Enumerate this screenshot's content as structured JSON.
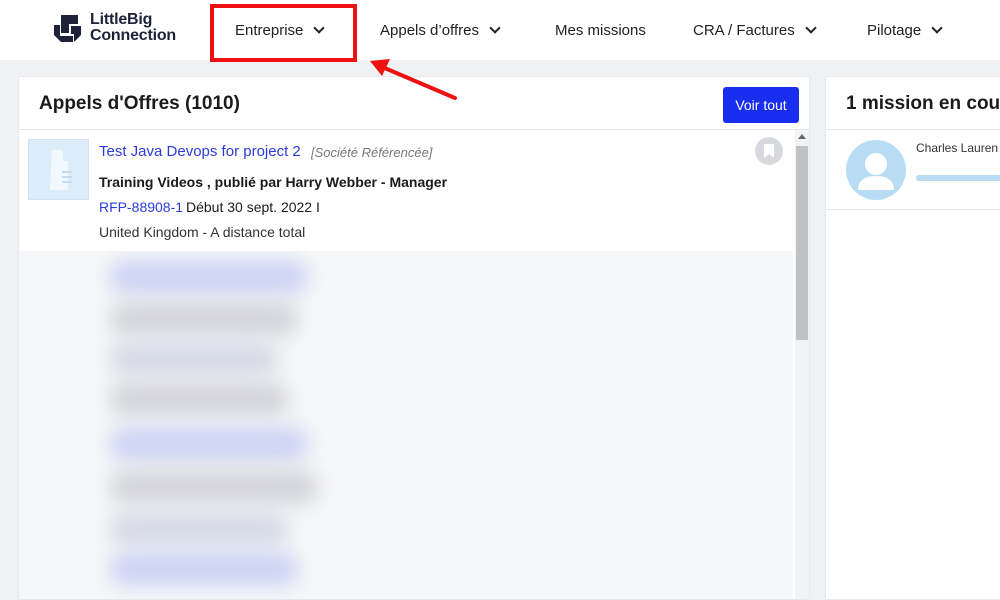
{
  "brand": {
    "line1": "LittleBig",
    "line2": "Connection"
  },
  "nav": {
    "items": [
      {
        "label": "Entreprise"
      },
      {
        "label": "Appels d’offres"
      },
      {
        "label": "Mes missions"
      },
      {
        "label": "CRA / Factures"
      },
      {
        "label": "Pilotage"
      }
    ]
  },
  "offers_panel": {
    "title": "Appels d'Offres (1010)",
    "view_all_label": "Voir tout",
    "offer": {
      "title": "Test Java Devops for project 2",
      "tag": "[Société Référencée]",
      "subtitle": "Training Videos , publié par Harry Webber - Manager",
      "ref": "RFP-88908-1",
      "date_text": "Début 30 sept. 2022 I",
      "location": "United Kingdom - A distance total"
    }
  },
  "missions_panel": {
    "title": "1 mission en cou",
    "mission": {
      "name": "Charles Lauren"
    }
  },
  "colors": {
    "accent": "#1a2ef0",
    "link": "#2a3cdc",
    "highlight": "#ee1111",
    "avatar": "#b9dcf5"
  },
  "icons": {
    "nav_dropdown": "chevron-down-icon",
    "bookmark": "bookmark-icon",
    "avatar": "user-avatar-icon",
    "annotation": "red-arrow-icon"
  }
}
